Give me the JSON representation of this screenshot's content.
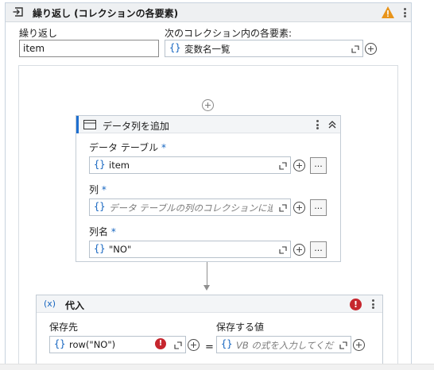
{
  "foreach": {
    "title": "繰り返し (コレクションの各要素)",
    "loop_var_label": "繰り返し",
    "loop_var_value": "item",
    "collection_label": "次のコレクション内の各要素:",
    "collection_value": "変数名一覧",
    "expr_brace": "{}"
  },
  "add_column": {
    "title": "データ列を追加",
    "datatable_label": "データ テーブル",
    "datatable_value": "item",
    "column_label": "列",
    "column_placeholder": "データ テーブルの列のコレクションに追加され",
    "colname_label": "列名",
    "colname_value": "\"NO\"",
    "required_mark": "*",
    "ellipsis": "..."
  },
  "assign": {
    "icon_text": "(x)",
    "title": "代入",
    "to_label": "保存先",
    "to_value": "row(\"NO\")",
    "value_label": "保存する値",
    "value_placeholder": "VB の式を入力してくださ",
    "equals": "=",
    "error_mark": "!"
  },
  "colors": {
    "accent": "#1e6fd0",
    "warning": "#e8941a",
    "error": "#c6262e",
    "brace": "#1565c0"
  }
}
